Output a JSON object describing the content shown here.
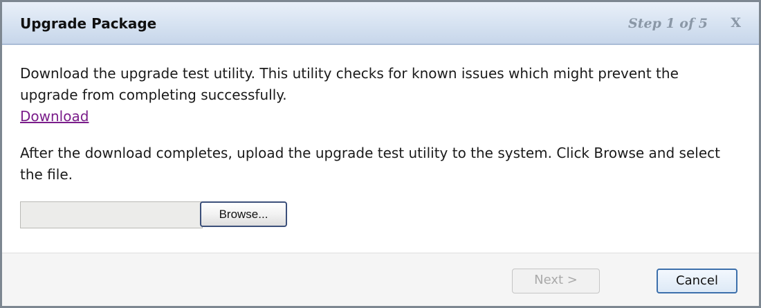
{
  "dialog": {
    "title": "Upgrade Package",
    "step_label": "Step 1 of 5",
    "close_label": "X"
  },
  "body": {
    "paragraph1": "Download the upgrade test utility. This utility checks for known issues which might prevent the upgrade from completing successfully.",
    "download_link": "Download",
    "paragraph2": "After the download completes, upload the upgrade test utility to the system. Click Browse and select the file.",
    "file_field_value": "",
    "browse_label": "Browse..."
  },
  "footer": {
    "next_label": "Next >",
    "next_enabled": false,
    "cancel_label": "Cancel"
  },
  "colors": {
    "titlebar": "#d6e2f1",
    "link": "#7a1d8a",
    "disabled_text": "#a9a9a9",
    "accent_border": "#3c6fab"
  }
}
